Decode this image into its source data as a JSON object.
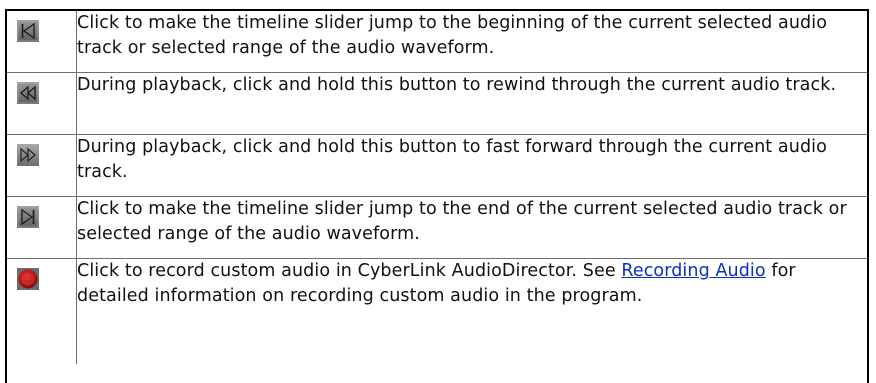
{
  "rows": [
    {
      "icon": "go-to-beginning-icon",
      "text": "Click to make the timeline slider jump to the beginning of the current selected audio track or selected range of the audio waveform."
    },
    {
      "icon": "rewind-icon",
      "text": "During playback, click and hold this button to rewind through the current audio track."
    },
    {
      "icon": "fast-forward-icon",
      "text": "During playback, click and hold this button to fast forward through the current audio track."
    },
    {
      "icon": "go-to-end-icon",
      "text": "Click to make the timeline slider jump to the end of the current selected audio track or selected range of the audio waveform."
    },
    {
      "icon": "record-icon",
      "text_before": "Click to record custom audio in CyberLink AudioDirector. See ",
      "link_text": "Recording Audio",
      "text_after": " for detailed information on recording custom audio in the program."
    }
  ],
  "colors": {
    "link": "#0a2fc8",
    "record": "#c0181c",
    "icon_gray": "#8a8a8a"
  }
}
